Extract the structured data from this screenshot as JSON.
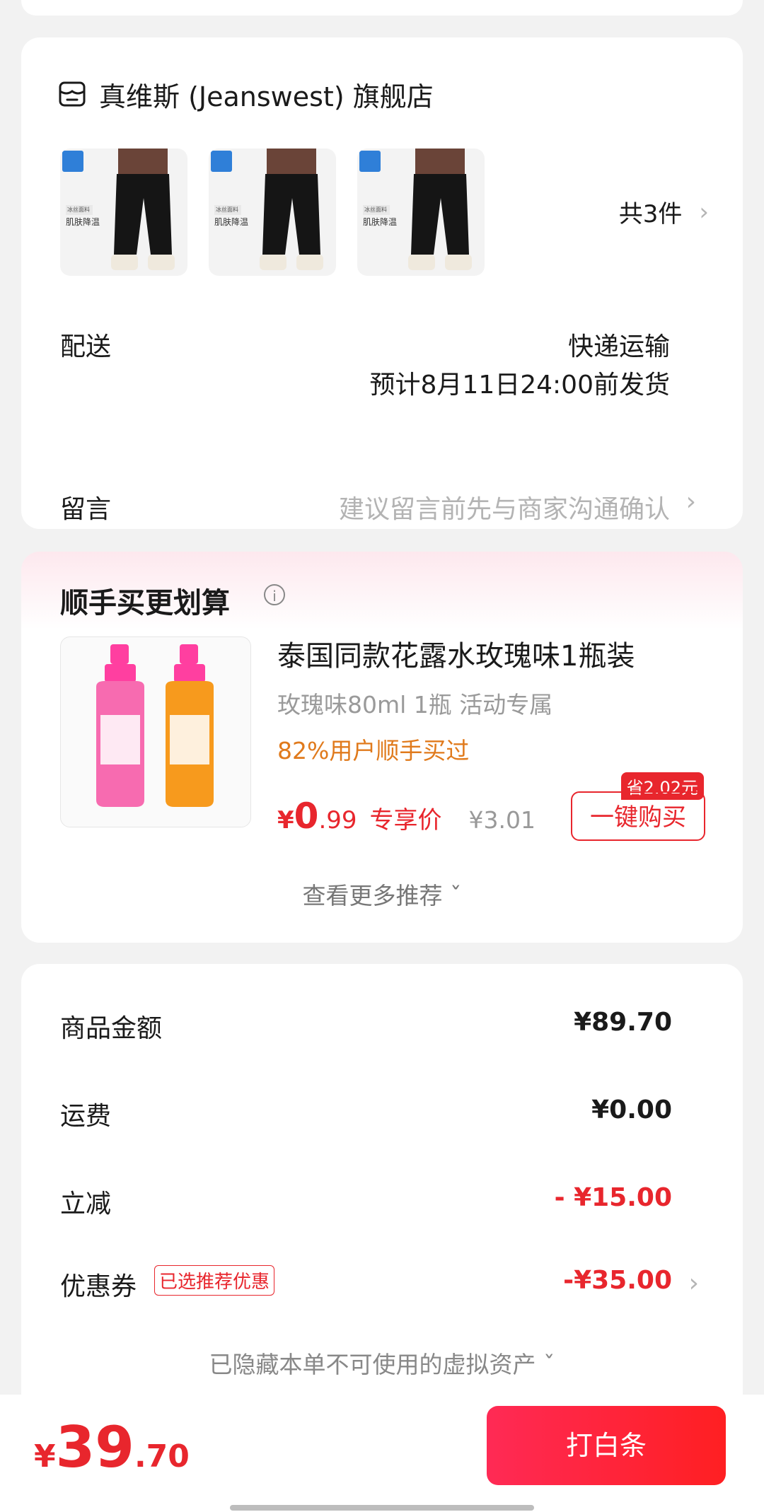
{
  "store": {
    "name": "真维斯 (Jeanswest) 旗舰店",
    "thumb_label_small": "冰丝面料",
    "thumb_label_big": "肌肤降温",
    "count": "共3件",
    "shipping_label": "配送",
    "shipping_method": "快递运输",
    "shipping_eta": "预计8月11日24:00前发货",
    "note_label": "留言",
    "note_placeholder": "建议留言前先与商家沟通确认"
  },
  "addon": {
    "title": "顺手买更划算",
    "product_name": "泰国同款花露水玫瑰味1瓶装",
    "spec": "玫瑰味80ml 1瓶 活动专属",
    "users": "82%用户顺手买过",
    "price_yen": "¥",
    "price_int": "0",
    "price_dec": ".99",
    "price_tag": "专享价",
    "price_orig": "¥3.01",
    "save_badge": "省2.02元",
    "buy_button": "一键购买",
    "more": "查看更多推荐 ˇ"
  },
  "summary": {
    "goods_label": "商品金额",
    "goods_value": "¥89.70",
    "freight_label": "运费",
    "freight_value": "¥0.00",
    "discount_label": "立减",
    "discount_value": "- ¥15.00",
    "coupon_label": "优惠券",
    "coupon_badge": "已选推荐优惠",
    "coupon_value": "-¥35.00",
    "hidden_assets": "已隐藏本单不可使用的虚拟资产 ˇ"
  },
  "bottom": {
    "total_yen": "¥",
    "total_int": "39",
    "total_dec": ".70",
    "pay_button": "打白条"
  },
  "colors": {
    "accent": "#e8262d",
    "orange": "#e07a1c",
    "background": "#f2f2f2"
  }
}
